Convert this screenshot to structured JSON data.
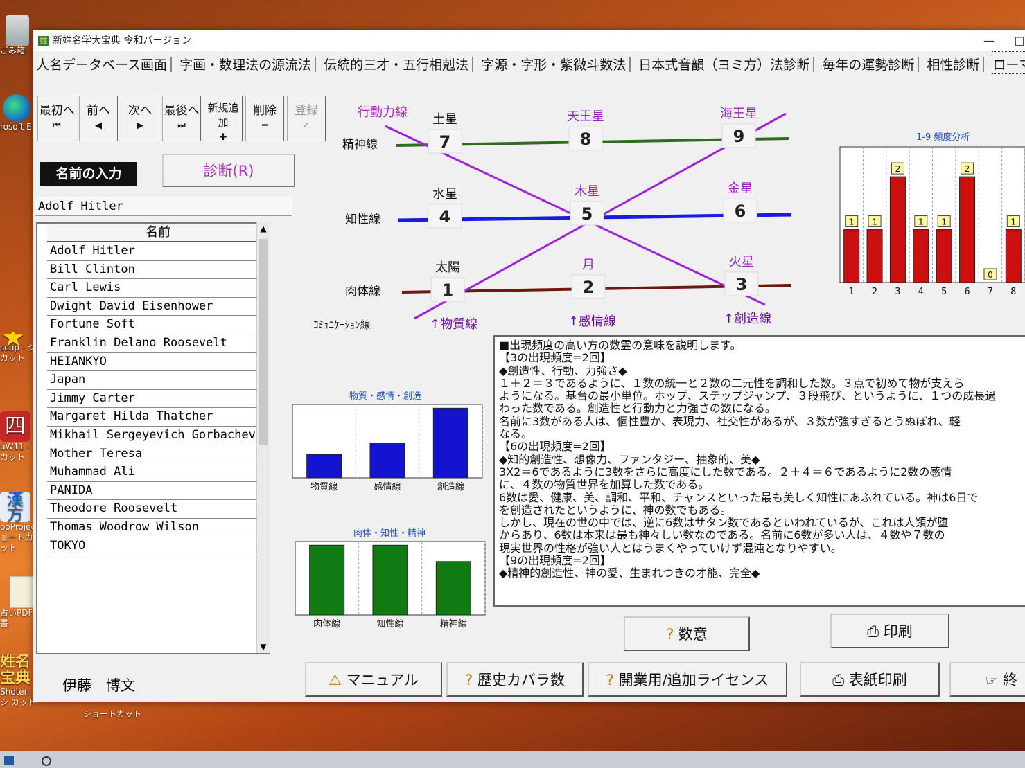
{
  "desktop": {
    "recycle_label": "ごみ箱",
    "edge_label": "rosoft E",
    "item3_label": "scop - シ カット",
    "item4_label": "uW11 - カット",
    "item5_label": "ooProject ョートカット",
    "item6_label": "占いPDF書",
    "item7_label": "Shoten - シ カット",
    "item7_tile": "姓名 宝典",
    "item4_tile": "四",
    "item5_tile": "漢 方",
    "shortcut_caption": "ショートカット"
  },
  "window": {
    "title": "新姓名学大宝典 令和バージョン",
    "min_glyph": "—",
    "max_glyph": "□"
  },
  "menu": {
    "items": [
      "人名データベース画面",
      "字画・数理法の源流法",
      "伝統的三才・五行相剋法",
      "字源・字形・紫微斗数法",
      "日本式音韻（ヨミ方）法診断",
      "毎年の運勢診断",
      "相性診断",
      "ローマ字名"
    ]
  },
  "toolbar": {
    "buttons": [
      {
        "label": "最初へ",
        "glyph": "⏮"
      },
      {
        "label": "前へ",
        "glyph": "◀"
      },
      {
        "label": "次へ",
        "glyph": "▶"
      },
      {
        "label": "最後へ",
        "glyph": "⏭"
      },
      {
        "label": "新規追加",
        "glyph": "✚"
      },
      {
        "label": "削除",
        "glyph": "━"
      },
      {
        "label": "登録",
        "glyph": "✓"
      }
    ]
  },
  "input": {
    "label": "名前の入力",
    "value": "Adolf Hitler",
    "diagnose_label": "診断(R)"
  },
  "name_list": {
    "header": "名前",
    "selected_marker": "▶",
    "rows": [
      "Adolf Hitler",
      "Bill Clinton",
      "Carl Lewis",
      "Dwight David Eisenhower",
      "Fortune Soft",
      "Franklin Delano Roosevelt",
      "HEIANKYO",
      "Japan",
      "Jimmy Carter",
      "Margaret Hilda Thatcher",
      "Mikhail Sergeyevich Gorbachev",
      "Mother Teresa",
      "Muhammad Ali",
      "PANIDA",
      "Theodore Roosevelt",
      "Thomas Woodrow Wilson",
      "TOKYO"
    ],
    "scroll_up": "▲",
    "scroll_down": "▼"
  },
  "grid": {
    "line_labels": {
      "spirit": "精神線",
      "intellect": "知性線",
      "body": "肉体線",
      "communication": "ｺﾐｭﾆｹｰｼｮﾝ線",
      "action": "行動力線"
    },
    "bottom_labels": {
      "material": "↑物質線",
      "emotion": "↑感情線",
      "creation": "↑創造線"
    },
    "cells": [
      {
        "planet": "土星",
        "num": "7"
      },
      {
        "planet": "天王星",
        "num": "8"
      },
      {
        "planet": "海王星",
        "num": "9"
      },
      {
        "planet": "水星",
        "num": "4"
      },
      {
        "planet": "木星",
        "num": "5"
      },
      {
        "planet": "金星",
        "num": "6"
      },
      {
        "planet": "太陽",
        "num": "1"
      },
      {
        "planet": "月",
        "num": "2"
      },
      {
        "planet": "火星",
        "num": "3"
      }
    ],
    "colors": {
      "spirit": "#2f6b20",
      "intellect": "#1a1ae0",
      "body": "#6b1a10",
      "diagonal": "#a020e0",
      "planet_label": "#9b20c8"
    }
  },
  "chart_data": [
    {
      "type": "bar",
      "title": "1-9 頻度分析",
      "categories": [
        "1",
        "2",
        "3",
        "4",
        "5",
        "6",
        "7",
        "8"
      ],
      "values": [
        1,
        1,
        2,
        1,
        1,
        2,
        0,
        1
      ],
      "ylim": [
        0,
        2
      ],
      "color": "#cc1010"
    },
    {
      "type": "bar",
      "title": "物質・感情・創造",
      "categories": [
        "物質線",
        "感情線",
        "創造線"
      ],
      "values": [
        1,
        1.5,
        3
      ],
      "ylim": [
        0,
        3
      ],
      "color": "#1414d0"
    },
    {
      "type": "bar",
      "title": "肉体・知性・精神",
      "categories": [
        "肉体線",
        "知性線",
        "精神線"
      ],
      "values": [
        3,
        3,
        2.3
      ],
      "ylim": [
        0,
        3
      ],
      "color": "#127a12"
    }
  ],
  "description": {
    "lines": [
      "■出現頻度の高い方の数霊の意味を説明します。",
      "【3の出現頻度=2回】",
      "◆創造性、行動、力強さ◆",
      "１＋２＝３であるように、１数の統一と２数の二元性を調和した数。３点で初めて物が支えら",
      "ようになる。基台の最小単位。ホップ、ステップジャンプ、３段飛び、というように、１つの成長過",
      "わった数である。創造性と行動力と力強さの数になる。",
      "名前に3数がある人は、個性豊か、表現力、社交性があるが、３数が強すぎるとうぬぼれ、軽",
      "なる。",
      "【6の出現頻度=2回】",
      "◆知的創造性、想像力、ファンタジー、抽象的、美◆",
      "3X2＝6であるように3数をさらに高度にした数である。２＋４＝６であるように2数の感情",
      "に、４数の物質世界を加算した数である。",
      "6数は愛、健康、美、調和、平和、チャンスといった最も美しく知性にあふれている。神は6日で",
      "を創造されたというように、神の数でもある。",
      "しかし、現在の世の中では、逆に6数はサタン数であるといわれているが、これは人類が堕",
      "からあり、6数は本来は最も神々しい数なのである。名前に6数が多い人は、４数や７数の",
      "現実世界の性格が強い人とはうまくやっていけず混沌となりやすい。",
      "【9の出現頻度=2回】",
      "◆精神的創造性、神の愛、生まれつきの才能、完全◆"
    ]
  },
  "buttons": {
    "meaning": "数意",
    "print": "印刷",
    "manual": "マニュアル",
    "history": "歴史カバラ数",
    "license": "開業用/追加ライセンス",
    "cover_print": "表紙印刷",
    "exit": "終"
  },
  "footer": {
    "user_name": "伊藤　博文"
  }
}
